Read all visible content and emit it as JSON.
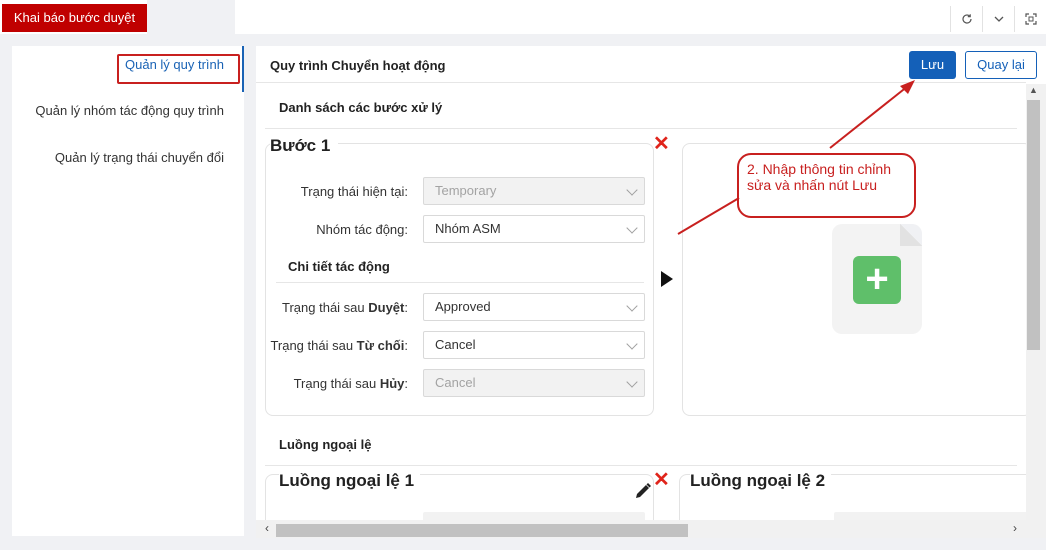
{
  "topbar": {
    "tab_label": "Khai báo bước duyệt",
    "icons": [
      "refresh-icon",
      "chevron-down-icon",
      "fullscreen-icon"
    ]
  },
  "sidebar": {
    "items": [
      {
        "label": "Quản lý quy trình",
        "active": true
      },
      {
        "label": "Quản lý nhóm tác động quy trình",
        "active": false
      },
      {
        "label": "Quản lý trạng thái chuyển đổi",
        "active": false
      }
    ]
  },
  "main": {
    "title": "Quy trình Chuyển hoạt động",
    "save_label": "Lưu",
    "back_label": "Quay lại",
    "steps_section": "Danh sách các bước xử lý",
    "step": {
      "title": "Bước 1",
      "current_status_label": "Trạng thái hiện tại:",
      "current_status_value": "Temporary",
      "group_label": "Nhóm tác động:",
      "group_value": "Nhóm ASM",
      "detail_heading": "Chi tiết tác động",
      "approve_prefix": "Trạng thái sau ",
      "approve_bold": "Duyệt",
      "approve_value": "Approved",
      "reject_prefix": "Trạng thái sau ",
      "reject_bold": "Từ chối",
      "reject_value": "Cancel",
      "cancel_prefix": "Trạng thái sau ",
      "cancel_bold": "Hủy",
      "cancel_value": "Cancel",
      "colon": ":"
    },
    "exceptions_section": "Luồng ngoại lệ",
    "exception_1_title": "Luồng ngoại lệ 1",
    "exception_2_title": "Luồng ngoại lệ 2"
  },
  "annotation": {
    "text": "2. Nhập thông tin chỉnh sửa và nhấn nút Lưu"
  },
  "colors": {
    "accent": "#1460b8",
    "tab_red": "#c00000",
    "annotation_red": "#c8201f",
    "add_green": "#5fbf6a",
    "remove_red": "#e0241b"
  }
}
